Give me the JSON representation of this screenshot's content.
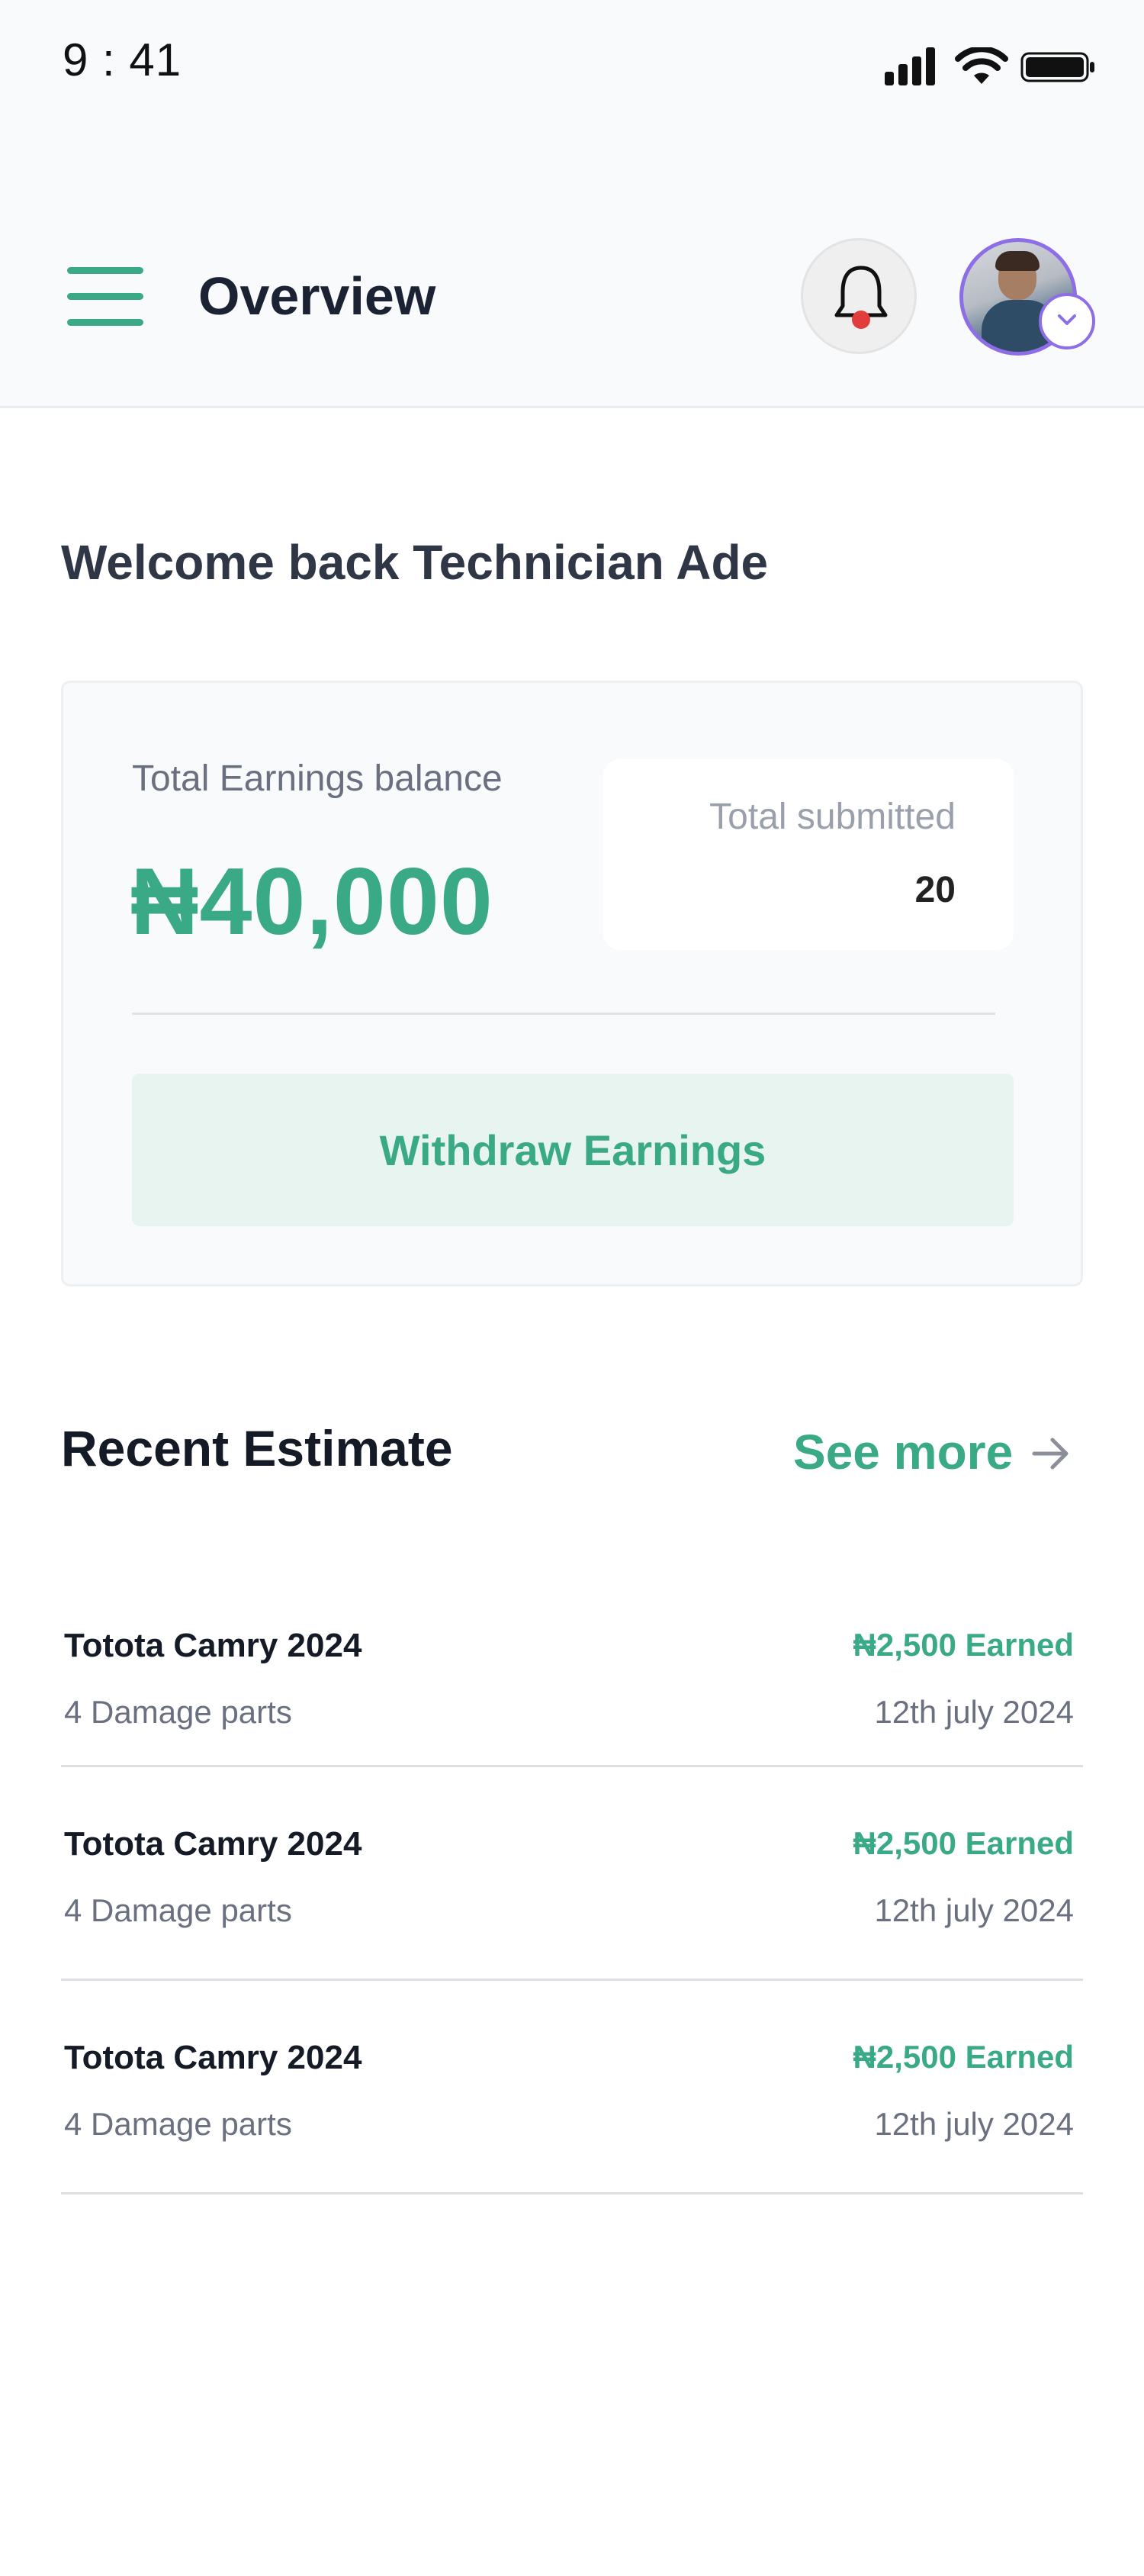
{
  "status_bar": {
    "time": "9 : 41",
    "icons": [
      "signal-icon",
      "wifi-icon",
      "battery-icon"
    ]
  },
  "header": {
    "title": "Overview",
    "menu_icon": "hamburger-menu-icon",
    "notification_icon": "bell-icon",
    "notification_dot_color": "#e23c3c",
    "avatar_ring_color": "#8d6ee6"
  },
  "welcome": {
    "text": "Welcome back Technician Ade"
  },
  "earnings_card": {
    "balance_label": "Total Earnings balance",
    "balance_value": "₦40,000",
    "submitted_label": "Total submitted",
    "submitted_value": "20",
    "withdraw_label": "Withdraw Earnings"
  },
  "recent": {
    "title": "Recent Estimate",
    "see_more_label": "See more",
    "see_more_icon": "arrow-right-icon",
    "items": [
      {
        "car": "Totota Camry 2024",
        "parts": "4 Damage parts",
        "earned": "₦2,500 Earned",
        "date": "12th july 2024"
      },
      {
        "car": "Totota Camry 2024",
        "parts": "4 Damage parts",
        "earned": "₦2,500 Earned",
        "date": "12th july 2024"
      },
      {
        "car": "Totota Camry 2024",
        "parts": "4 Damage parts",
        "earned": "₦2,500 Earned",
        "date": "12th july 2024"
      }
    ]
  },
  "colors": {
    "accent": "#3aa985",
    "accent_light": "#e7f4ef",
    "text_dark": "#141a26",
    "text_muted": "#6a7080"
  }
}
